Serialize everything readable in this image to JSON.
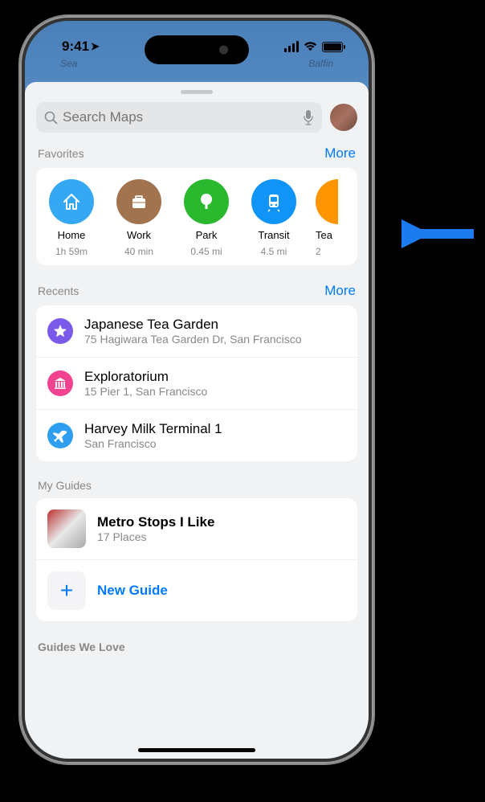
{
  "statusBar": {
    "time": "9:41"
  },
  "search": {
    "placeholder": "Search Maps"
  },
  "map": {
    "label1": "Sea",
    "label2": "Baffin"
  },
  "sections": {
    "favorites": {
      "title": "Favorites",
      "more": "More"
    },
    "recents": {
      "title": "Recents",
      "more": "More"
    },
    "guides": {
      "title": "My Guides"
    },
    "guidesLove": {
      "title": "Guides We Love"
    }
  },
  "favorites": [
    {
      "label": "Home",
      "sub": "1h 59m",
      "color": "bg-blue",
      "icon": "house-icon"
    },
    {
      "label": "Work",
      "sub": "40 min",
      "color": "bg-brown",
      "icon": "briefcase-icon"
    },
    {
      "label": "Park",
      "sub": "0.45 mi",
      "color": "bg-green",
      "icon": "tree-icon"
    },
    {
      "label": "Transit",
      "sub": "4.5 mi",
      "color": "bg-transitblue",
      "icon": "tram-icon"
    },
    {
      "label": "Tea",
      "sub": "2",
      "color": "bg-orange",
      "icon": ""
    }
  ],
  "recents": [
    {
      "title": "Japanese Tea Garden",
      "sub": "75 Hagiwara Tea Garden Dr, San Francisco",
      "color": "bg-purple",
      "icon": "star-icon"
    },
    {
      "title": "Exploratorium",
      "sub": "15 Pier 1, San Francisco",
      "color": "bg-pink",
      "icon": "museum-icon"
    },
    {
      "title": "Harvey Milk Terminal 1",
      "sub": "San Francisco",
      "color": "bg-lightblue",
      "icon": "plane-icon"
    }
  ],
  "guides": {
    "item": {
      "title": "Metro Stops I Like",
      "sub": "17 Places"
    },
    "newGuide": "New Guide"
  }
}
